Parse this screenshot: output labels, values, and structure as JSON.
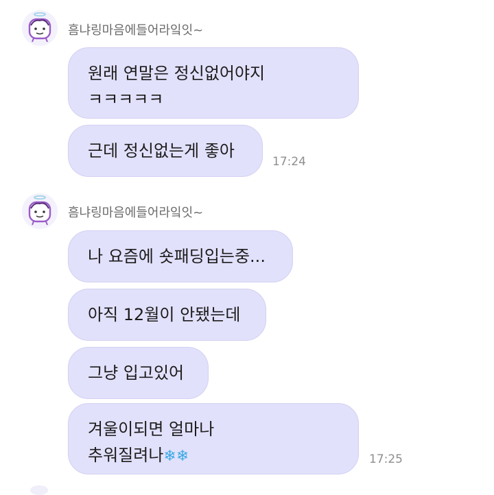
{
  "chat": {
    "groups": [
      {
        "sender_name": "흠냐링마음에들어라잌잇~",
        "messages": [
          {
            "lines": [
              "원래 연말은 정신없어야지",
              "ㅋㅋㅋㅋㅋ"
            ]
          },
          {
            "lines": [
              "근데 정신없는게 좋아"
            ],
            "time": "17:24"
          }
        ]
      },
      {
        "sender_name": "흠냐링마음에들어라잌잇~",
        "messages": [
          {
            "lines": [
              "나 요즘에 숏패딩입는중..."
            ]
          },
          {
            "lines": [
              "아직 12월이 안됐는데"
            ]
          },
          {
            "lines": [
              "그냥 입고있어"
            ]
          },
          {
            "lines": [
              "겨울이되면 얼마나",
              "추워질려나"
            ],
            "emoji": [
              "❄",
              "❄"
            ],
            "time": "17:25"
          }
        ]
      }
    ]
  },
  "icons": {
    "avatar": "cartoon-face-avatar-icon",
    "emoji": "snowflake-icon"
  },
  "colors": {
    "bubble_background": "#e2e1fb",
    "bubble_border": "#d2d0f2",
    "sender_text": "#6b6b6b",
    "timestamp_text": "#8e8e8e",
    "snowflake": "#3aa9e6"
  }
}
